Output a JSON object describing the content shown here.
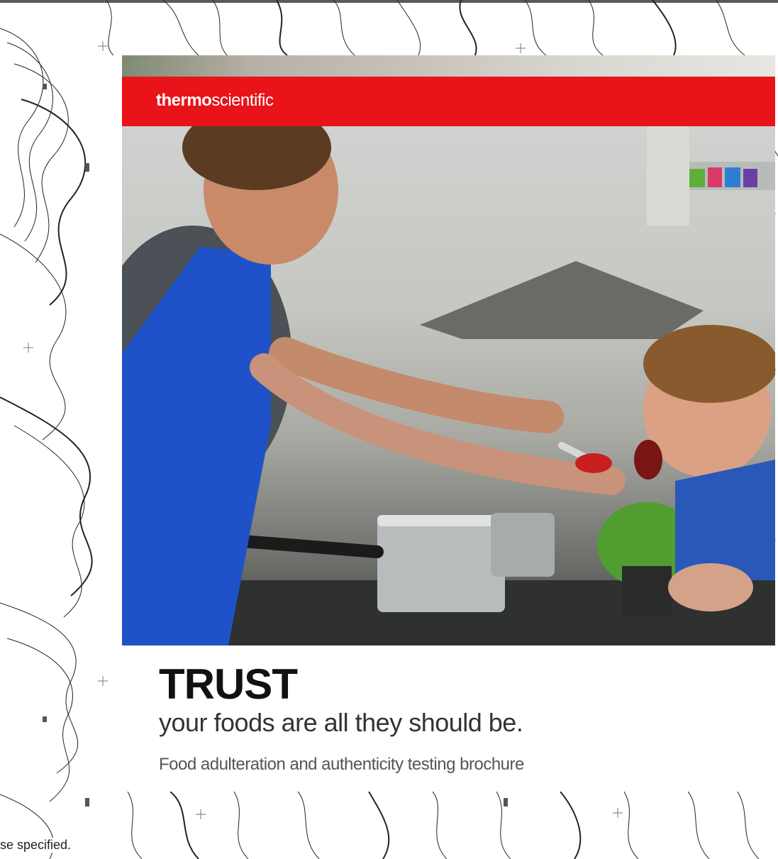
{
  "brand": {
    "logo_bold": "thermo",
    "logo_light": "scientific"
  },
  "cover": {
    "title": "TRUST",
    "subtitle": "your foods are all they should be.",
    "caption": "Food adulteration and authenticity testing brochure"
  },
  "footer": {
    "note": "se specified."
  },
  "colors": {
    "brand_red": "#e8141a",
    "topographic_lines": "#222222",
    "apron_blue": "#1f52c9"
  }
}
